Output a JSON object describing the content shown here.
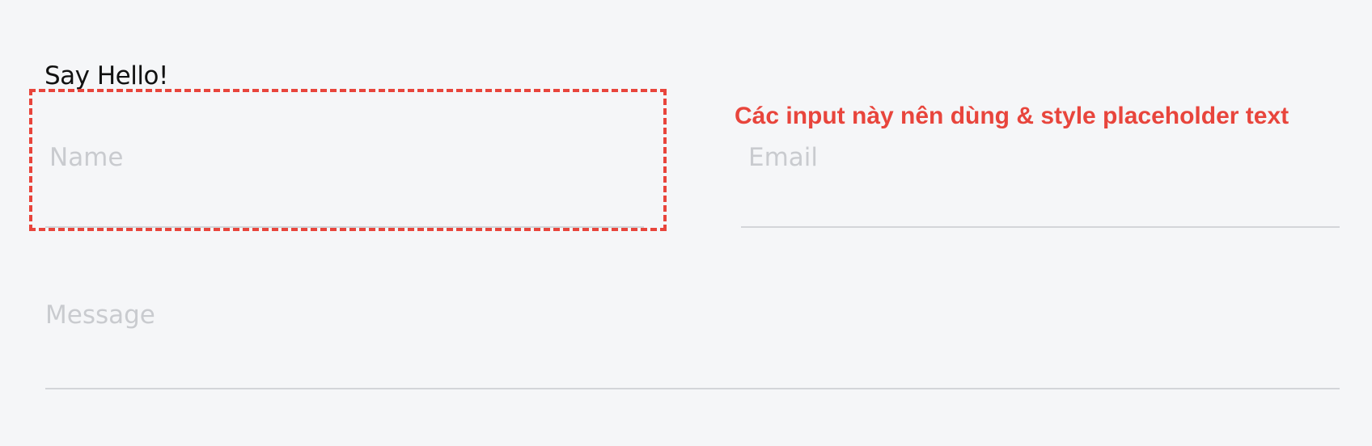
{
  "form": {
    "title": "Say Hello!",
    "name_placeholder": "Name",
    "email_placeholder": "Email",
    "message_placeholder": "Message"
  },
  "annotation": {
    "text": "Các input này nên dùng & style placeholder text",
    "color": "#e8453c"
  },
  "colors": {
    "background": "#f5f6f8",
    "placeholder": "#c9cbcf",
    "underline": "#d3d5d9"
  }
}
